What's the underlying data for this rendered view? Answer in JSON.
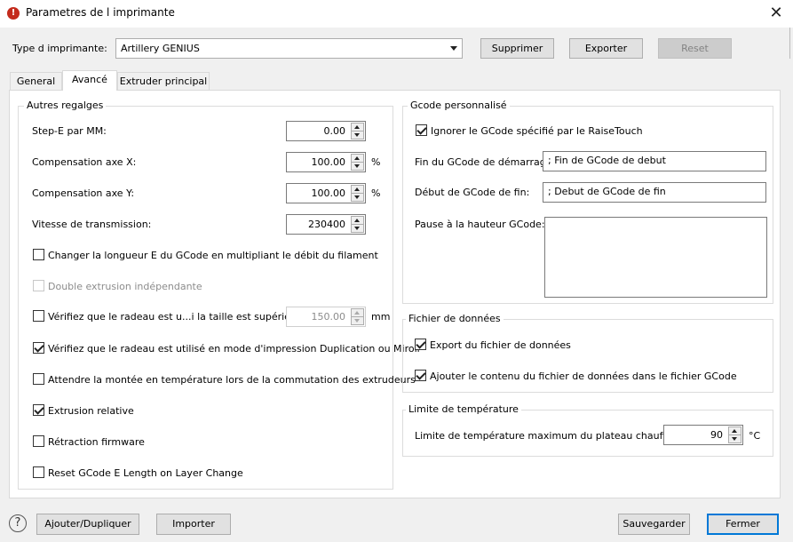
{
  "window": {
    "title": "Parametres de l imprimante",
    "close_glyph": "✕"
  },
  "header": {
    "printer_type_label": "Type d imprimante:",
    "printer_selected": "Artillery GENIUS",
    "delete": "Supprimer",
    "export": "Exporter",
    "reset": "Reset"
  },
  "tabs": [
    "General",
    "Avancé",
    "Extruder principal"
  ],
  "other": {
    "title": "Autres regalges",
    "fields": [
      {
        "label": "Step-E par MM:",
        "value": "0.00",
        "unit": ""
      },
      {
        "label": "Compensation axe X:",
        "value": "100.00",
        "unit": "%"
      },
      {
        "label": "Compensation axe Y:",
        "value": "100.00",
        "unit": "%"
      },
      {
        "label": "Vitesse de transmission:",
        "value": "230400",
        "unit": ""
      }
    ],
    "checks": [
      {
        "label": "Changer la longueur E du GCode en multipliant le débit du filament",
        "checked": false,
        "enabled": true
      },
      {
        "label": "Double extrusion indépendante",
        "checked": false,
        "enabled": false
      },
      {
        "label": "Vérifiez que le radeau est u...i la taille est supérieure à",
        "checked": false,
        "enabled": true
      },
      {
        "label": "Vérifiez que le radeau est utilisé en mode d'impression Duplication ou Miroir",
        "checked": true,
        "enabled": true
      },
      {
        "label": "Attendre la montée en température lors de la commutation des extrudeurs",
        "checked": false,
        "enabled": true
      },
      {
        "label": "Extrusion relative",
        "checked": true,
        "enabled": true
      },
      {
        "label": "Rétraction firmware",
        "checked": false,
        "enabled": true
      },
      {
        "label": "Reset GCode E Length on Layer Change",
        "checked": false,
        "enabled": true
      }
    ],
    "raft_value": "150.00",
    "raft_unit": "mm"
  },
  "gcode": {
    "title": "Gcode personnalisé",
    "ignore_label": "Ignorer le GCode spécifié par le RaiseTouch",
    "start_end_label": "Fin du GCode de démarrage:",
    "start_end_value": "; Fin de GCode de debut",
    "end_start_label": "Début de GCode de fin:",
    "end_start_value": "; Debut  de GCode de fin",
    "pause_label": "Pause à la hauteur GCode:"
  },
  "datafile": {
    "title": "Fichier de données",
    "export_label": "Export du fichier de données",
    "append_label": "Ajouter le contenu du fichier de données dans le fichier GCode"
  },
  "temp": {
    "title": "Limite de température",
    "label": "Limite de température maximum du plateau chauffant:",
    "value": "90",
    "unit": "°C"
  },
  "footer": {
    "help_glyph": "?",
    "add": "Ajouter/Dupliquer",
    "import": "Importer",
    "save": "Sauvegarder",
    "close": "Fermer"
  }
}
